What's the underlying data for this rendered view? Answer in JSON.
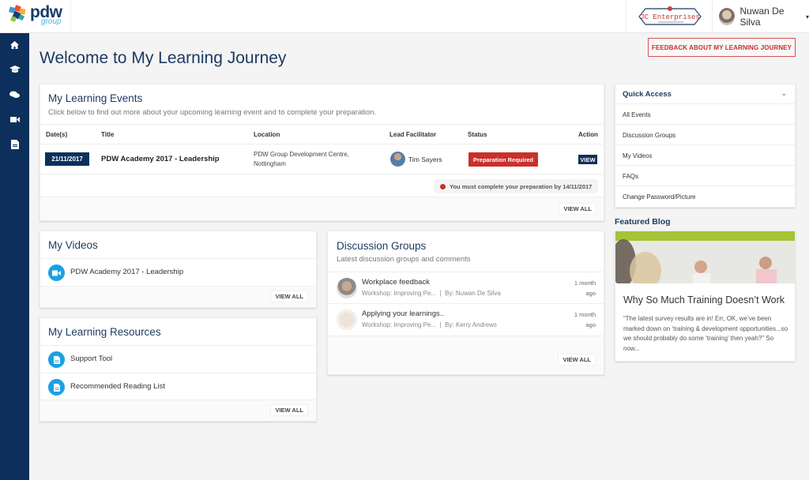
{
  "header": {
    "logo_text": "pdw",
    "logo_sub": "group",
    "client_logo_text": "JC Enterprises",
    "user_name": "Nuwan De Silva",
    "user_caret": "▾"
  },
  "sidebar": {
    "items": [
      {
        "name": "home",
        "glyph": "⌂"
      },
      {
        "name": "graduation-cap",
        "glyph": "🎓"
      },
      {
        "name": "comments",
        "glyph": "💬"
      },
      {
        "name": "video-camera",
        "glyph": "■"
      },
      {
        "name": "document",
        "glyph": "▤"
      }
    ]
  },
  "page": {
    "title": "Welcome to My Learning Journey",
    "feedback_button": "FEEDBACK ABOUT MY LEARNING JOURNEY"
  },
  "events": {
    "title": "My Learning Events",
    "subtitle": "Click below to find out more about your upcoming learning event and to complete your preparation.",
    "columns": [
      "Date(s)",
      "Title",
      "Location",
      "Lead Facilitator",
      "Status",
      "Action"
    ],
    "rows": [
      {
        "date": "21/11/2017",
        "title": "PDW Academy 2017 - Leadership",
        "location_line1": "PDW Group Development Centre,",
        "location_line2": "Nottingham",
        "facilitator": "Tim Sayers",
        "status": "Preparation Required",
        "action": "VIEW"
      }
    ],
    "prep_note": "You must complete your preparation by 14/11/2017",
    "view_all": "VIEW ALL"
  },
  "videos": {
    "title": "My Videos",
    "items": [
      "PDW Academy 2017 - Leadership"
    ],
    "view_all": "VIEW ALL"
  },
  "resources": {
    "title": "My Learning Resources",
    "items": [
      "Support Tool",
      "Recommended Reading List"
    ],
    "view_all": "VIEW ALL"
  },
  "discussion": {
    "title": "Discussion Groups",
    "subtitle": "Latest discussion groups and comments",
    "items": [
      {
        "title": "Workplace feedback",
        "group": "Workshop: Improving Pe...",
        "separator": "|",
        "author": "By: Nuwan De Silva",
        "time1": "1 month",
        "time2": "ago"
      },
      {
        "title": "Applying your learnings..",
        "group": "Workshop: Improving Pe...",
        "separator": "|",
        "author": "By: Kerry Andrews",
        "time1": "1 month",
        "time2": "ago"
      }
    ],
    "view_all": "VIEW ALL"
  },
  "quick_access": {
    "title": "Quick Access",
    "chevron": "⌄",
    "items": [
      "All Events",
      "Discussion Groups",
      "My Videos",
      "FAQs",
      "Change Password/Picture"
    ]
  },
  "blog": {
    "heading": "Featured Blog",
    "title": "Why So Much Training Doesn’t Work",
    "excerpt": "“The latest survey results are in! Err, OK, we’ve been marked down on ‘training & development opportunities...so we should probably do some ‘training’ then yeah?” So now..."
  },
  "colors": {
    "brand_navy": "#0d2f5c",
    "accent_blue": "#1ba1e2",
    "status_red": "#c9302c",
    "title_blue": "#1b3a5f"
  }
}
